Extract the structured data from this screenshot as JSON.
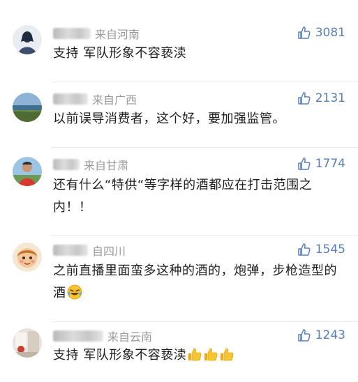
{
  "comments": [
    {
      "location": "来自河南",
      "likes": "3081",
      "text": "支持 军队形象不容亵渎",
      "suffix_emoji": "",
      "avatar": "silhouette-avatar"
    },
    {
      "location": "来自广西",
      "likes": "2131",
      "text": "以前误导消费者，这个好，要加强监管。",
      "suffix_emoji": "",
      "avatar": "landscape-avatar"
    },
    {
      "location": "来自甘肃",
      "likes": "1774",
      "text": "还有什么“特供“等字样的酒都应在打击范围之内！！",
      "suffix_emoji": "",
      "avatar": "person-avatar"
    },
    {
      "location": "自四川",
      "likes": "1545",
      "text": "之前直播里面蛮多这种的酒的，炮弹，步枪造型的酒",
      "suffix_emoji": "laughing-crying-emoji",
      "avatar": "cartoon-avatar"
    },
    {
      "location": "来自云南",
      "likes": "1243",
      "text": "支持 军队形象不容亵渎",
      "suffix_emoji": "thumbs-up-emoji x3",
      "avatar": "room-avatar"
    }
  ],
  "colors": {
    "like_blue": "#5a7fb8",
    "meta_gray": "#9a9a9a",
    "text_dark": "#1e1e1e"
  }
}
